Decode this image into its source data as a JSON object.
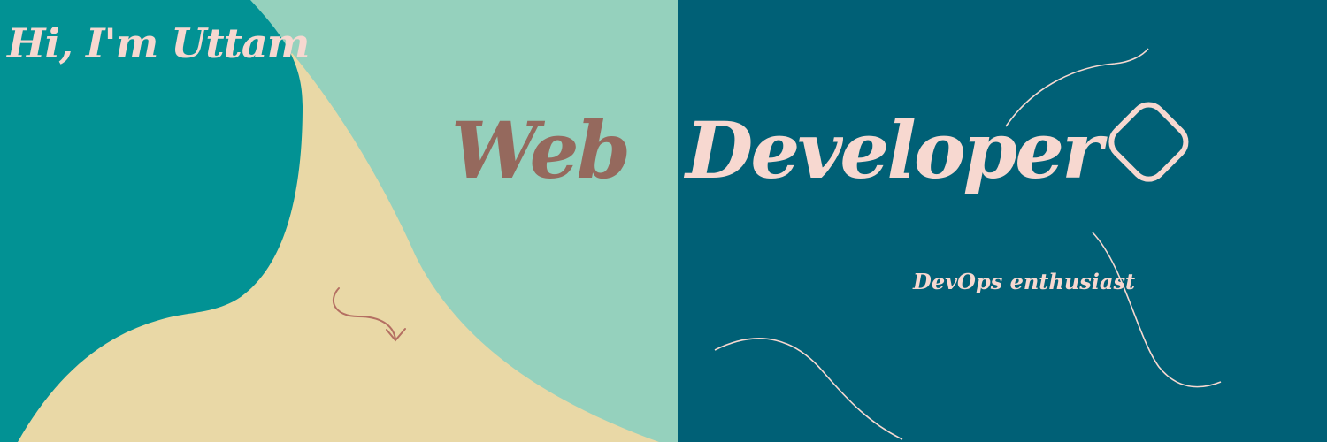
{
  "greeting": "Hi, I'm Uttam",
  "title_word_1": "Web",
  "title_word_2": "Developer",
  "tagline": "DevOps enthusiast",
  "colors": {
    "teal": "#029294",
    "mint": "#95d1bd",
    "beige": "#e9d8a6",
    "dark_teal": "#006076",
    "pink": "#f7d8d0",
    "brown": "#95695d"
  },
  "icons": [
    "curved-arrow-icon",
    "rounded-square-icon",
    "decorative-curve-lines"
  ]
}
